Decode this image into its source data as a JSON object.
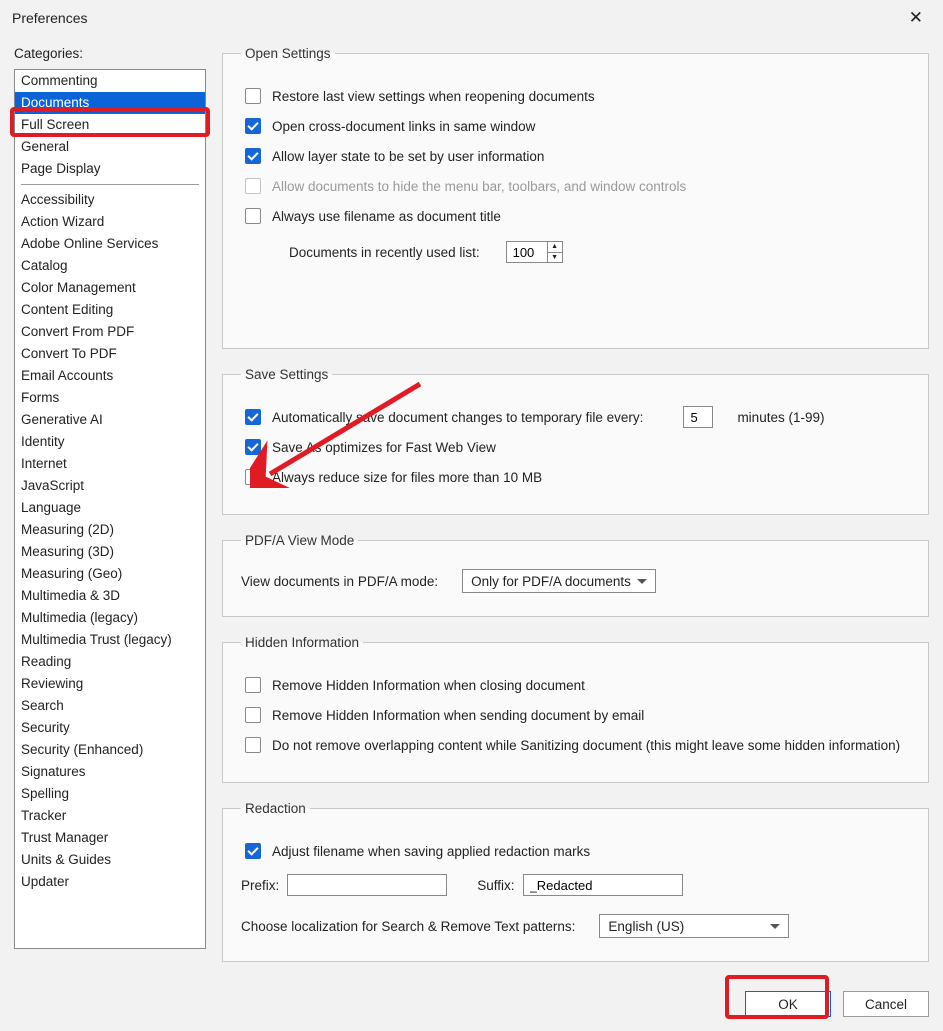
{
  "window": {
    "title": "Preferences"
  },
  "categories": {
    "label": "Categories:",
    "top": [
      "Commenting",
      "Documents",
      "Full Screen",
      "General",
      "Page Display"
    ],
    "selected": "Documents",
    "bottom": [
      "Accessibility",
      "Action Wizard",
      "Adobe Online Services",
      "Catalog",
      "Color Management",
      "Content Editing",
      "Convert From PDF",
      "Convert To PDF",
      "Email Accounts",
      "Forms",
      "Generative AI",
      "Identity",
      "Internet",
      "JavaScript",
      "Language",
      "Measuring (2D)",
      "Measuring (3D)",
      "Measuring (Geo)",
      "Multimedia & 3D",
      "Multimedia (legacy)",
      "Multimedia Trust (legacy)",
      "Reading",
      "Reviewing",
      "Search",
      "Security",
      "Security (Enhanced)",
      "Signatures",
      "Spelling",
      "Tracker",
      "Trust Manager",
      "Units & Guides",
      "Updater"
    ]
  },
  "open": {
    "legend": "Open Settings",
    "restore": "Restore last view settings when reopening documents",
    "crosslinks": "Open cross-document links in same window",
    "layerstate": "Allow layer state to be set by user information",
    "hidebars": "Allow documents to hide the menu bar, toolbars, and window controls",
    "filenameTitle": "Always use filename as document title",
    "recentLabel": "Documents in recently used list:",
    "recentValue": "100"
  },
  "save": {
    "legend": "Save Settings",
    "autosave": "Automatically save document changes to temporary file every:",
    "autosaveValue": "5",
    "minutes": "minutes (1-99)",
    "fastweb": "Save As optimizes for Fast Web View",
    "reduce": "Always reduce size for files more than 10 MB"
  },
  "pdfa": {
    "legend": "PDF/A View Mode",
    "label": "View documents in PDF/A mode:",
    "value": "Only for PDF/A documents"
  },
  "hidden": {
    "legend": "Hidden Information",
    "close": "Remove Hidden Information when closing document",
    "send": "Remove Hidden Information when sending document by email",
    "overlap": "Do not remove overlapping content while Sanitizing document (this might leave some hidden information)"
  },
  "redaction": {
    "legend": "Redaction",
    "adjust": "Adjust filename when saving applied redaction marks",
    "prefixLabel": "Prefix:",
    "prefixValue": "",
    "suffixLabel": "Suffix:",
    "suffixValue": "_Redacted",
    "localizeLabel": "Choose localization for Search & Remove Text patterns:",
    "localizeValue": "English (US)"
  },
  "buttons": {
    "ok": "OK",
    "cancel": "Cancel"
  }
}
